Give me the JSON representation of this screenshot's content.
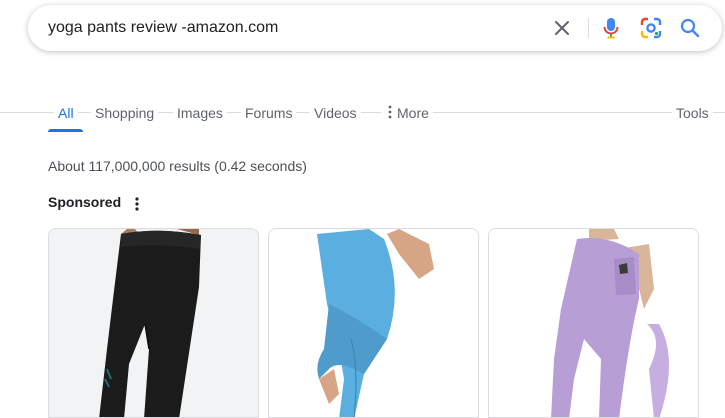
{
  "search": {
    "query": "yoga pants review -amazon.com",
    "clear_icon": "close-icon",
    "voice_icon": "mic-icon",
    "lens_icon": "lens-icon",
    "search_icon": "search-icon"
  },
  "tabs": [
    {
      "label": "All",
      "active": true
    },
    {
      "label": "Shopping"
    },
    {
      "label": "Images"
    },
    {
      "label": "Forums"
    },
    {
      "label": "Videos"
    },
    {
      "label": "More",
      "icon": "vertical-dots-icon"
    }
  ],
  "tools_label": "Tools",
  "results_stats": "About 117,000,000 results (0.42 seconds)",
  "sponsored": {
    "label": "Sponsored",
    "menu_icon": "vertical-dots-icon"
  },
  "products": [
    {
      "color": "#1b1b1b",
      "image": "black-yoga-pants"
    },
    {
      "color": "#5aaee0",
      "image": "blue-yoga-pants"
    },
    {
      "color": "#b79ed4",
      "image": "purple-yoga-pants"
    }
  ],
  "colors": {
    "accent": "#1a73e8",
    "tab_text": "#5f6368",
    "stats_text": "#4d5156"
  }
}
